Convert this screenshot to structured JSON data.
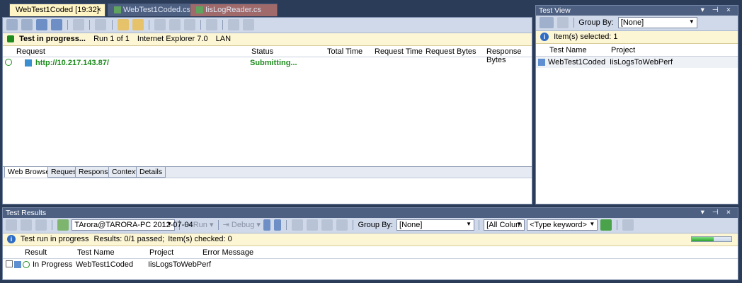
{
  "doc_tabs": [
    {
      "label": "WebTest1Coded [19:32]",
      "close": "×"
    },
    {
      "label": "WebTest1Coded.cs"
    },
    {
      "label": "IisLogReader.cs"
    }
  ],
  "webtest": {
    "status": {
      "label": "Test in progress...",
      "run": "Run 1 of 1",
      "browser": "Internet Explorer 7.0",
      "network": "LAN"
    },
    "columns": {
      "request": "Request",
      "status": "Status",
      "total_time": "Total Time",
      "request_time": "Request Time",
      "request_bytes": "Request Bytes",
      "response_bytes": "Response Bytes"
    },
    "rows": [
      {
        "request": "http://10.217.143.87/",
        "status": "Submitting..."
      }
    ],
    "bottom_tabs": [
      "Web Browser",
      "Request",
      "Response",
      "Context",
      "Details"
    ]
  },
  "test_view": {
    "title": "Test View",
    "title_controls": "▾ ⊣ ×",
    "group_by_label": "Group By:",
    "group_by_value": "[None]",
    "info": "Item(s) selected: 1",
    "columns": {
      "test_name": "Test Name",
      "project": "Project"
    },
    "rows": [
      {
        "test_name": "WebTest1Coded",
        "project": "IisLogsToWebPerf"
      }
    ]
  },
  "test_results": {
    "title": "Test Results",
    "title_controls": "▾ ⊣ ×",
    "run_select": "TArora@TARORA-PC 2012-07-04",
    "run_label": "Run",
    "debug_label": "Debug",
    "group_by_label": "Group By:",
    "group_by_value": "[None]",
    "columns_select": "[All Colum",
    "keyword_select": "<Type keyword>",
    "info": {
      "status": "Test run in progress",
      "results": "Results: 0/1 passed;",
      "checked": "Item(s) checked: 0"
    },
    "progress": 0.55,
    "columns": {
      "result": "Result",
      "test_name": "Test Name",
      "project": "Project",
      "error": "Error Message"
    },
    "rows": [
      {
        "result": "In Progress",
        "test_name": "WebTest1Coded",
        "project": "IisLogsToWebPerf",
        "error": ""
      }
    ]
  },
  "colors": {
    "accent_green": "#1d8b1d",
    "info_bg": "#fdf6d5",
    "title_bg": "#4d6082"
  }
}
